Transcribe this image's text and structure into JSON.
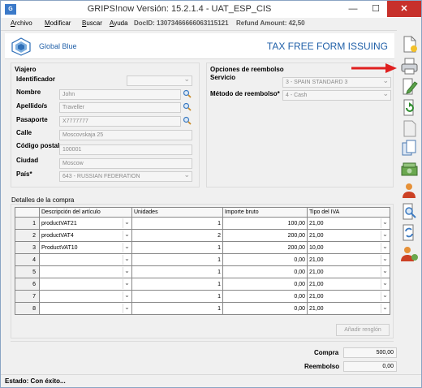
{
  "window": {
    "title": "GRIPS!now Versión: 15.2.1.4 - UAT_ESP_CIS",
    "app_icon": "G",
    "min": "—",
    "max": "☐",
    "close": "✕"
  },
  "menu": {
    "items": [
      {
        "underline": "A",
        "rest": "rchivo"
      },
      {
        "underline": "M",
        "rest": "odificar"
      },
      {
        "underline": "B",
        "rest": "uscar"
      },
      {
        "underline": "A",
        "rest": "yuda"
      }
    ],
    "doc_id": "DocID: 13073466666063115121",
    "refund_amount": "Refund Amount: 42,50"
  },
  "header": {
    "logo_text": "Global Blue",
    "form_title": "TAX FREE FORM ISSUING",
    "brand_color": "#1f5fa8"
  },
  "viajero": {
    "title": "Viajero",
    "identificador_label": "Identificador",
    "identificador_value": "",
    "nombre_label": "Nombre",
    "nombre_value": "John",
    "apellido_label": "Apellido/s",
    "apellido_value": "Traveller",
    "pasaporte_label": "Pasaporte",
    "pasaporte_value": "X7777777",
    "calle_label": "Calle",
    "calle_value": "Moscovskaja 25",
    "codigo_postal_label": "Código postal",
    "codigo_postal_value": "100001",
    "ciudad_label": "Ciudad",
    "ciudad_value": "Moscow",
    "pais_label": "País*",
    "pais_value": "643 - RUSSIAN FEDERATION"
  },
  "reembolso": {
    "title": "Opciones de reembolso",
    "servicio_label": "Servicio",
    "servicio_value": "3 - SPAIN STANDARD 3",
    "metodo_label": "Método de reembolso*",
    "metodo_value": "4 - Cash"
  },
  "detalles": {
    "title": "Detalles de la compra",
    "columns": [
      "",
      "Descripción del artículo",
      "Unidades",
      "Importe bruto",
      "Tipo del IVA"
    ],
    "rows": [
      {
        "n": "1",
        "desc": "productVAT21",
        "units": "1",
        "amount": "100,00",
        "iva": "21,00"
      },
      {
        "n": "2",
        "desc": "productVAT4",
        "units": "2",
        "amount": "200,00",
        "iva": "21,00"
      },
      {
        "n": "3",
        "desc": "ProductVAT10",
        "units": "1",
        "amount": "200,00",
        "iva": "10,00"
      },
      {
        "n": "4",
        "desc": "",
        "units": "1",
        "amount": "0,00",
        "iva": "21,00"
      },
      {
        "n": "5",
        "desc": "",
        "units": "1",
        "amount": "0,00",
        "iva": "21,00"
      },
      {
        "n": "6",
        "desc": "",
        "units": "1",
        "amount": "0,00",
        "iva": "21,00"
      },
      {
        "n": "7",
        "desc": "",
        "units": "1",
        "amount": "0,00",
        "iva": "21,00"
      },
      {
        "n": "8",
        "desc": "",
        "units": "1",
        "amount": "0,00",
        "iva": "21,00"
      }
    ],
    "add_row_label": "Añadir renglón"
  },
  "totals": {
    "compra_label": "Compra",
    "compra_value": "500,00",
    "reembolso_label": "Reembolso",
    "reembolso_value": "0,00"
  },
  "status": {
    "text": "Estado:  Con éxito..."
  },
  "toolbar": [
    "new-document-icon",
    "print-icon",
    "edit-document-icon",
    "refresh-document-icon",
    "blank-document-icon",
    "copy-document-icon",
    "money-icon",
    "user-icon",
    "search-document-icon",
    "sync-document-icon",
    "user-add-icon"
  ]
}
